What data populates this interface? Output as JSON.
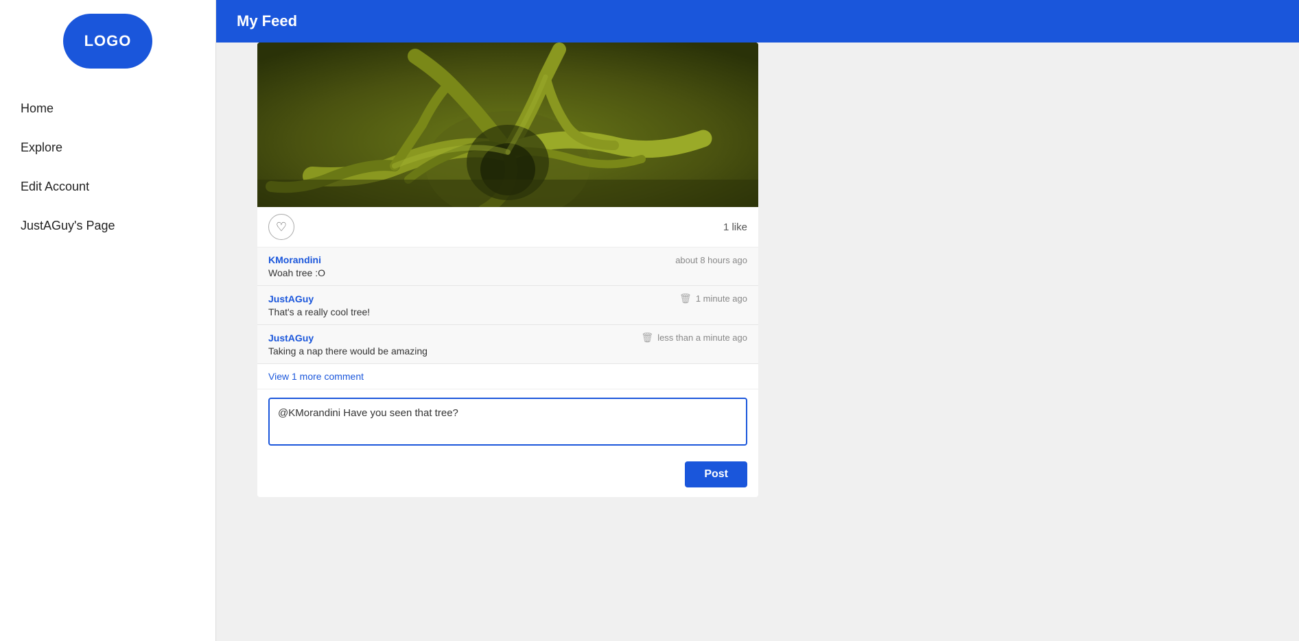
{
  "sidebar": {
    "logo_text": "LOGO",
    "nav_items": [
      {
        "label": "Home",
        "id": "home"
      },
      {
        "label": "Explore",
        "id": "explore"
      },
      {
        "label": "Edit Account",
        "id": "edit-account"
      },
      {
        "label": "JustAGuy's Page",
        "id": "justaguy-page"
      }
    ]
  },
  "header": {
    "title": "My Feed"
  },
  "post": {
    "like_count": "1 like",
    "comments": [
      {
        "username": "KMorandini",
        "timestamp": "about 8 hours ago",
        "text": "Woah tree :O",
        "has_delete": false
      },
      {
        "username": "JustAGuy",
        "timestamp": "1 minute ago",
        "text": "That's a really cool tree!",
        "has_delete": true
      },
      {
        "username": "JustAGuy",
        "timestamp": "less than a minute ago",
        "text": "Taking a nap there would be amazing",
        "has_delete": true
      }
    ],
    "view_more_label": "View 1 more comment",
    "comment_input_value": "@KMorandini Have you seen that tree?",
    "post_button_label": "Post"
  }
}
